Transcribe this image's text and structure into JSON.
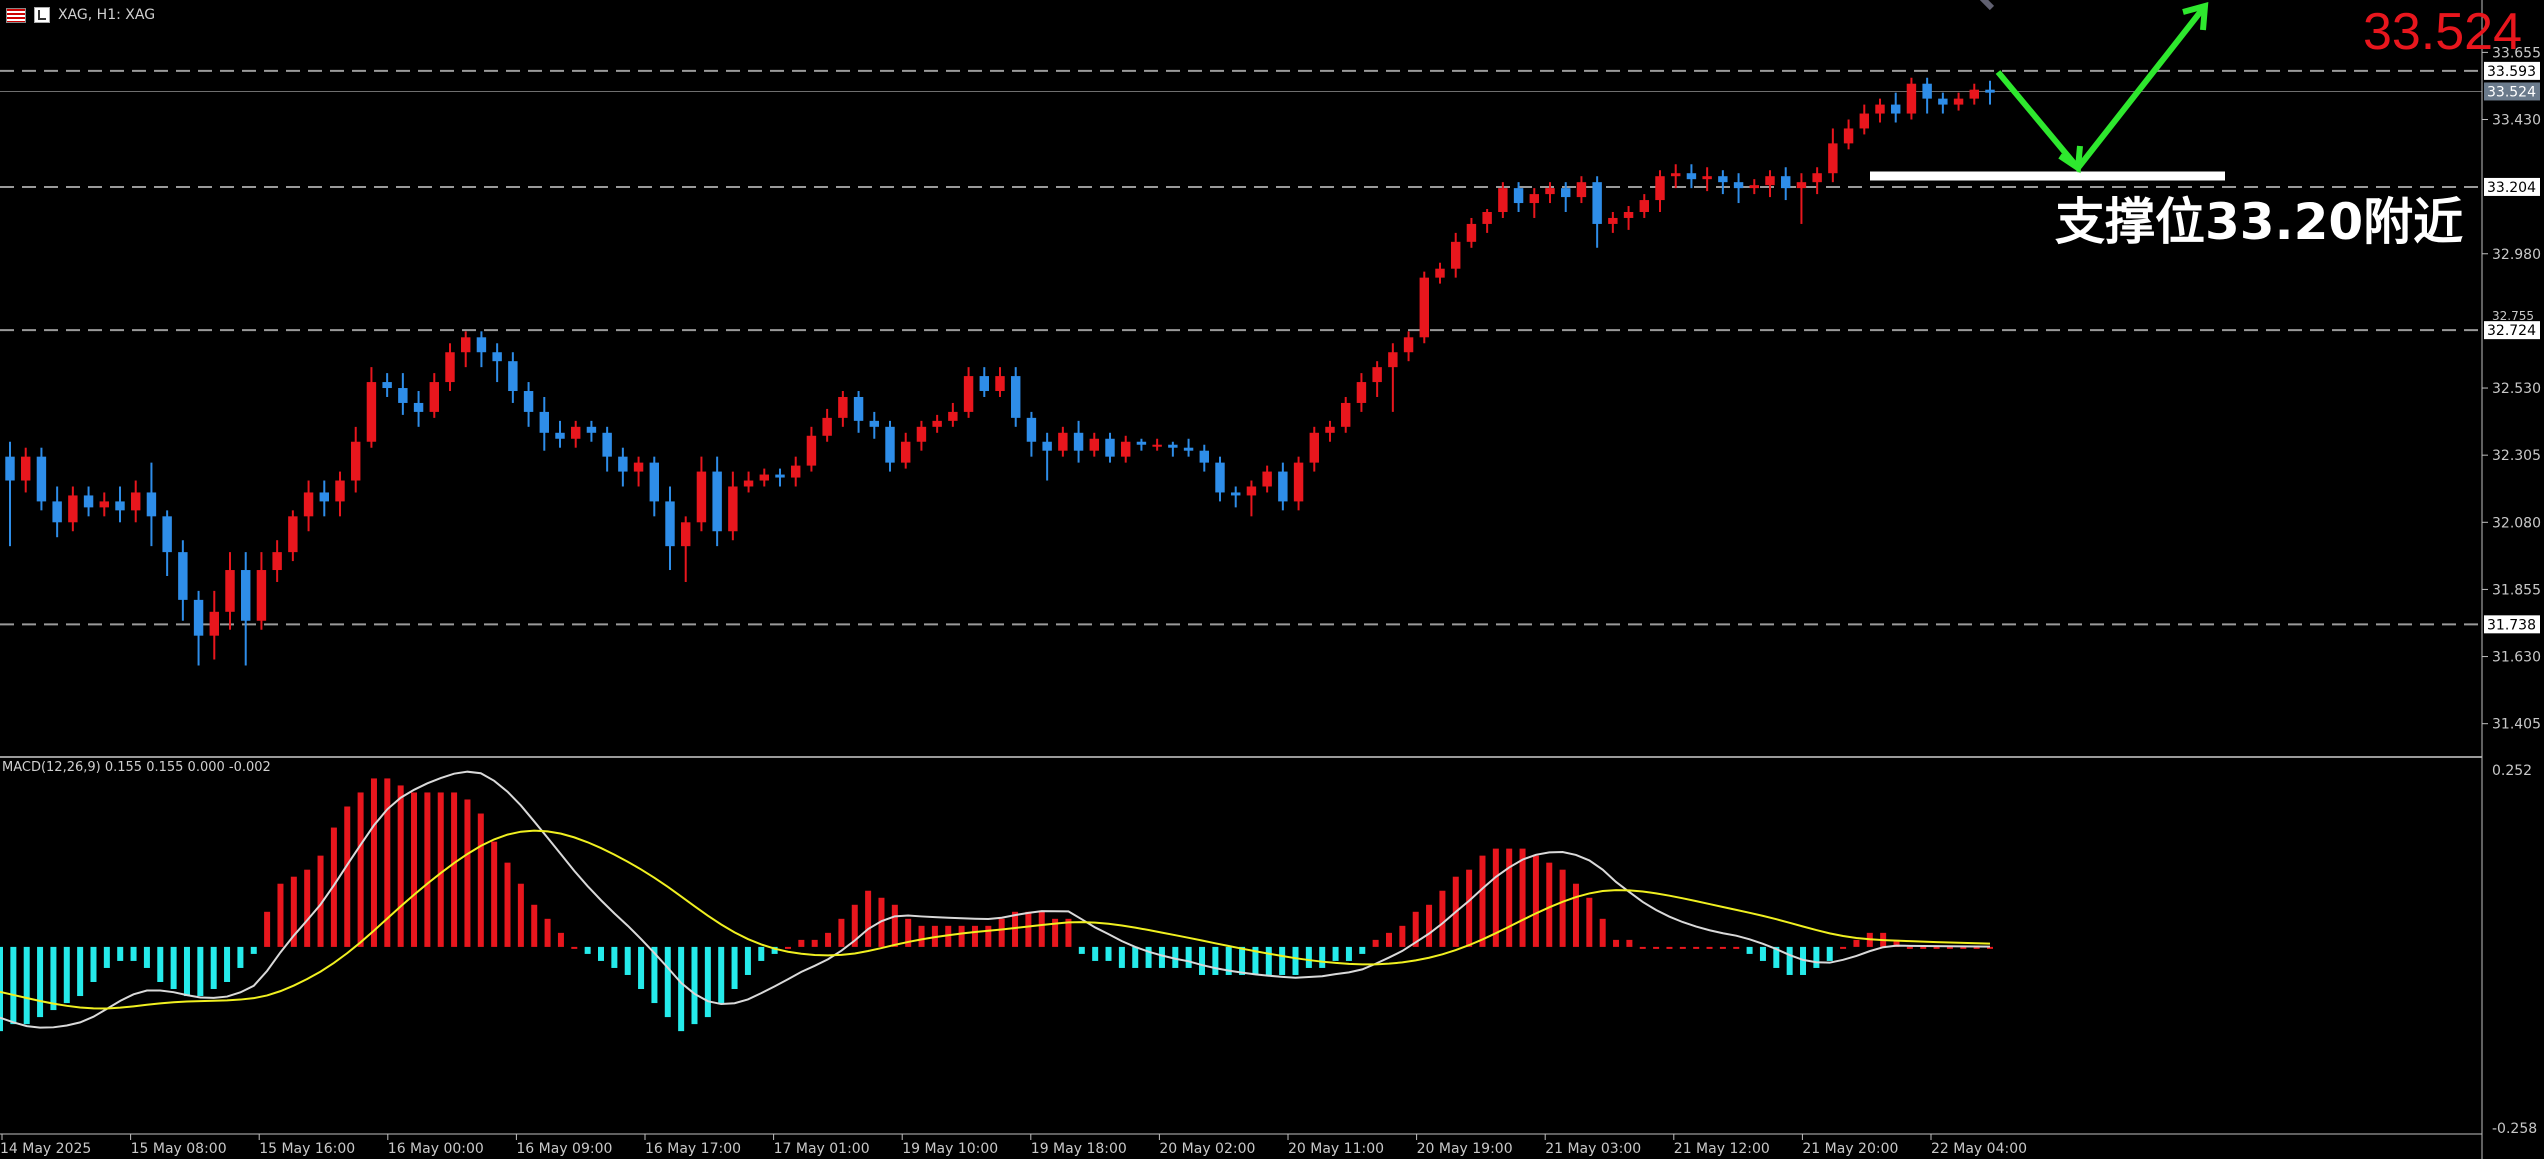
{
  "header": {
    "title": "XAG, H1: XAG",
    "flag_icon": "us-flag-icon",
    "symbol_icon": "chart-symbol-icon"
  },
  "annotations": {
    "price_label": "33.524",
    "support_label": "支撑位33.20附近"
  },
  "macd": {
    "label": "MACD(12,26,9) 0.155 0.155 0.000 -0.002",
    "axis_max": "0.252",
    "axis_min": "-0.258",
    "hist": [
      -0.12,
      -0.11,
      -0.11,
      -0.1,
      -0.09,
      -0.08,
      -0.07,
      -0.05,
      -0.03,
      -0.02,
      -0.02,
      -0.03,
      -0.05,
      -0.06,
      -0.07,
      -0.07,
      -0.06,
      -0.05,
      -0.03,
      -0.01,
      0.05,
      0.09,
      0.1,
      0.11,
      0.13,
      0.17,
      0.2,
      0.22,
      0.24,
      0.24,
      0.23,
      0.22,
      0.22,
      0.22,
      0.22,
      0.21,
      0.19,
      0.15,
      0.12,
      0.09,
      0.06,
      0.04,
      0.02,
      0.0,
      -0.01,
      -0.02,
      -0.03,
      -0.04,
      -0.06,
      -0.08,
      -0.1,
      -0.12,
      -0.11,
      -0.1,
      -0.08,
      -0.06,
      -0.04,
      -0.02,
      -0.01,
      0.0,
      0.01,
      0.01,
      0.02,
      0.04,
      0.06,
      0.08,
      0.07,
      0.06,
      0.04,
      0.03,
      0.03,
      0.03,
      0.03,
      0.03,
      0.03,
      0.04,
      0.05,
      0.05,
      0.05,
      0.04,
      0.04,
      -0.01,
      -0.02,
      -0.02,
      -0.03,
      -0.03,
      -0.03,
      -0.03,
      -0.03,
      -0.03,
      -0.04,
      -0.04,
      -0.04,
      -0.04,
      -0.04,
      -0.04,
      -0.04,
      -0.04,
      -0.03,
      -0.03,
      -0.02,
      -0.02,
      -0.01,
      0.01,
      0.02,
      0.03,
      0.05,
      0.06,
      0.08,
      0.1,
      0.11,
      0.13,
      0.14,
      0.14,
      0.14,
      0.13,
      0.12,
      0.11,
      0.09,
      0.07,
      0.04,
      0.01,
      0.01,
      0.0,
      0.0,
      0.0,
      0.0,
      0.0,
      0.0,
      0.0,
      0.0,
      -0.01,
      -0.02,
      -0.03,
      -0.04,
      -0.04,
      -0.03,
      -0.02,
      0.0,
      0.01,
      0.02,
      0.02,
      0.01,
      0.0,
      0.0,
      0.0,
      0.0,
      0.0,
      0.0,
      0.0
    ]
  },
  "price_axis": {
    "ticks": [
      "33.655",
      "33.430",
      "32.980",
      "32.530",
      "32.305",
      "32.080",
      "31.855",
      "31.630",
      "31.405"
    ],
    "boxed": [
      {
        "label": "33.593",
        "style": "level"
      },
      {
        "label": "33.524",
        "style": "bid"
      },
      {
        "label": "33.204",
        "style": "level"
      },
      {
        "label": "32.724",
        "style": "level"
      },
      {
        "label": "31.738",
        "style": "level"
      }
    ],
    "partial_label": "32.755"
  },
  "time_axis": [
    "14 May 2025",
    "15 May 08:00",
    "15 May 16:00",
    "16 May 00:00",
    "16 May 09:00",
    "16 May 17:00",
    "17 May 01:00",
    "19 May 10:00",
    "19 May 18:00",
    "20 May 02:00",
    "20 May 11:00",
    "20 May 19:00",
    "21 May 03:00",
    "21 May 12:00",
    "21 May 20:00",
    "22 May 04:00"
  ],
  "colors": {
    "bull": "#e8161d",
    "bear": "#2e8de8",
    "macd_pos": "#e8161d",
    "macd_neg": "#25ebeb",
    "macd_line": "#d9d9d9",
    "signal_line": "#f0f020",
    "arrow": "#2ee82e",
    "support_bar": "#ffffff"
  },
  "chart_data": {
    "type": "candlestick",
    "title": "XAG, H1",
    "y_range": [
      31.29,
      33.73
    ],
    "horizontal_levels": [
      33.593,
      33.204,
      32.724,
      31.738
    ],
    "current_price": 33.524,
    "candles": [
      [
        32.3,
        32.22,
        32.35,
        32.0
      ],
      [
        32.22,
        32.3,
        32.33,
        32.18
      ],
      [
        32.3,
        32.15,
        32.33,
        32.12
      ],
      [
        32.15,
        32.08,
        32.2,
        32.03
      ],
      [
        32.08,
        32.17,
        32.2,
        32.05
      ],
      [
        32.17,
        32.13,
        32.2,
        32.1
      ],
      [
        32.13,
        32.15,
        32.18,
        32.1
      ],
      [
        32.15,
        32.12,
        32.2,
        32.08
      ],
      [
        32.12,
        32.18,
        32.22,
        32.08
      ],
      [
        32.18,
        32.1,
        32.28,
        32.0
      ],
      [
        32.1,
        31.98,
        32.12,
        31.9
      ],
      [
        31.98,
        31.82,
        32.02,
        31.75
      ],
      [
        31.82,
        31.7,
        31.85,
        31.6
      ],
      [
        31.7,
        31.78,
        31.85,
        31.62
      ],
      [
        31.78,
        31.92,
        31.98,
        31.72
      ],
      [
        31.92,
        31.75,
        31.98,
        31.6
      ],
      [
        31.75,
        31.92,
        31.98,
        31.72
      ],
      [
        31.92,
        31.98,
        32.02,
        31.88
      ],
      [
        31.98,
        32.1,
        32.12,
        31.95
      ],
      [
        32.1,
        32.18,
        32.22,
        32.05
      ],
      [
        32.18,
        32.15,
        32.22,
        32.1
      ],
      [
        32.15,
        32.22,
        32.25,
        32.1
      ],
      [
        32.22,
        32.35,
        32.4,
        32.18
      ],
      [
        32.35,
        32.55,
        32.6,
        32.33
      ],
      [
        32.55,
        32.53,
        32.58,
        32.5
      ],
      [
        32.53,
        32.48,
        32.58,
        32.44
      ],
      [
        32.48,
        32.45,
        32.52,
        32.4
      ],
      [
        32.45,
        32.55,
        32.58,
        32.43
      ],
      [
        32.55,
        32.65,
        32.68,
        32.52
      ],
      [
        32.65,
        32.7,
        32.72,
        32.6
      ],
      [
        32.7,
        32.65,
        32.72,
        32.6
      ],
      [
        32.65,
        32.62,
        32.68,
        32.55
      ],
      [
        32.62,
        32.52,
        32.65,
        32.48
      ],
      [
        32.52,
        32.45,
        32.55,
        32.4
      ],
      [
        32.45,
        32.38,
        32.5,
        32.32
      ],
      [
        32.38,
        32.36,
        32.42,
        32.33
      ],
      [
        32.36,
        32.4,
        32.42,
        32.33
      ],
      [
        32.4,
        32.38,
        32.42,
        32.35
      ],
      [
        32.38,
        32.3,
        32.4,
        32.25
      ],
      [
        32.3,
        32.25,
        32.33,
        32.2
      ],
      [
        32.25,
        32.28,
        32.3,
        32.2
      ],
      [
        32.28,
        32.15,
        32.3,
        32.1
      ],
      [
        32.15,
        32.0,
        32.2,
        31.92
      ],
      [
        32.0,
        32.08,
        32.1,
        31.88
      ],
      [
        32.08,
        32.25,
        32.3,
        32.05
      ],
      [
        32.25,
        32.05,
        32.3,
        32.0
      ],
      [
        32.05,
        32.2,
        32.25,
        32.02
      ],
      [
        32.2,
        32.22,
        32.25,
        32.18
      ],
      [
        32.22,
        32.24,
        32.26,
        32.2
      ],
      [
        32.24,
        32.23,
        32.26,
        32.2
      ],
      [
        32.23,
        32.27,
        32.3,
        32.2
      ],
      [
        32.27,
        32.37,
        32.4,
        32.25
      ],
      [
        32.37,
        32.43,
        32.46,
        32.35
      ],
      [
        32.43,
        32.5,
        32.52,
        32.4
      ],
      [
        32.5,
        32.42,
        32.52,
        32.38
      ],
      [
        32.42,
        32.4,
        32.45,
        32.36
      ],
      [
        32.4,
        32.28,
        32.42,
        32.25
      ],
      [
        32.28,
        32.35,
        32.38,
        32.26
      ],
      [
        32.35,
        32.4,
        32.42,
        32.32
      ],
      [
        32.4,
        32.42,
        32.44,
        32.38
      ],
      [
        32.42,
        32.45,
        32.48,
        32.4
      ],
      [
        32.45,
        32.57,
        32.6,
        32.43
      ],
      [
        32.57,
        32.52,
        32.6,
        32.5
      ],
      [
        32.52,
        32.57,
        32.6,
        32.5
      ],
      [
        32.57,
        32.43,
        32.6,
        32.4
      ],
      [
        32.43,
        32.35,
        32.45,
        32.3
      ],
      [
        32.35,
        32.32,
        32.38,
        32.22
      ],
      [
        32.32,
        32.38,
        32.4,
        32.3
      ],
      [
        32.38,
        32.32,
        32.42,
        32.28
      ],
      [
        32.32,
        32.36,
        32.38,
        32.3
      ],
      [
        32.36,
        32.3,
        32.38,
        32.28
      ],
      [
        32.3,
        32.35,
        32.37,
        32.28
      ],
      [
        32.35,
        32.34,
        32.36,
        32.32
      ],
      [
        32.34,
        32.34,
        32.36,
        32.32
      ],
      [
        32.34,
        32.33,
        32.35,
        32.3
      ],
      [
        32.33,
        32.32,
        32.36,
        32.3
      ],
      [
        32.32,
        32.28,
        32.34,
        32.25
      ],
      [
        32.28,
        32.18,
        32.3,
        32.15
      ],
      [
        32.18,
        32.17,
        32.2,
        32.13
      ],
      [
        32.17,
        32.2,
        32.22,
        32.1
      ],
      [
        32.2,
        32.25,
        32.27,
        32.18
      ],
      [
        32.25,
        32.15,
        32.28,
        32.12
      ],
      [
        32.15,
        32.28,
        32.3,
        32.12
      ],
      [
        32.28,
        32.38,
        32.4,
        32.25
      ],
      [
        32.38,
        32.4,
        32.42,
        32.35
      ],
      [
        32.4,
        32.48,
        32.5,
        32.38
      ],
      [
        32.48,
        32.55,
        32.58,
        32.45
      ],
      [
        32.55,
        32.6,
        32.62,
        32.5
      ],
      [
        32.6,
        32.65,
        32.68,
        32.45
      ],
      [
        32.65,
        32.7,
        32.72,
        32.62
      ],
      [
        32.7,
        32.9,
        32.92,
        32.68
      ],
      [
        32.9,
        32.93,
        32.95,
        32.88
      ],
      [
        32.93,
        33.02,
        33.05,
        32.9
      ],
      [
        33.02,
        33.08,
        33.1,
        33.0
      ],
      [
        33.08,
        33.12,
        33.13,
        33.05
      ],
      [
        33.12,
        33.2,
        33.22,
        33.1
      ],
      [
        33.2,
        33.15,
        33.22,
        33.12
      ],
      [
        33.15,
        33.18,
        33.2,
        33.1
      ],
      [
        33.18,
        33.2,
        33.22,
        33.15
      ],
      [
        33.2,
        33.17,
        33.22,
        33.12
      ],
      [
        33.17,
        33.22,
        33.24,
        33.15
      ],
      [
        33.22,
        33.08,
        33.24,
        33.0
      ],
      [
        33.08,
        33.1,
        33.12,
        33.05
      ],
      [
        33.1,
        33.12,
        33.14,
        33.06
      ],
      [
        33.12,
        33.16,
        33.18,
        33.1
      ],
      [
        33.16,
        33.24,
        33.26,
        33.12
      ],
      [
        33.24,
        33.25,
        33.28,
        33.2
      ],
      [
        33.25,
        33.23,
        33.28,
        33.2
      ],
      [
        33.23,
        33.24,
        33.27,
        33.19
      ],
      [
        33.24,
        33.22,
        33.26,
        33.18
      ],
      [
        33.22,
        33.2,
        33.25,
        33.15
      ],
      [
        33.2,
        33.21,
        33.23,
        33.18
      ],
      [
        33.21,
        33.24,
        33.26,
        33.17
      ],
      [
        33.24,
        33.2,
        33.27,
        33.16
      ],
      [
        33.2,
        33.22,
        33.25,
        33.08
      ],
      [
        33.22,
        33.25,
        33.27,
        33.18
      ],
      [
        33.25,
        33.35,
        33.4,
        33.22
      ],
      [
        33.35,
        33.4,
        33.43,
        33.33
      ],
      [
        33.4,
        33.45,
        33.48,
        33.38
      ],
      [
        33.45,
        33.48,
        33.5,
        33.42
      ],
      [
        33.48,
        33.45,
        33.52,
        33.42
      ],
      [
        33.45,
        33.55,
        33.57,
        33.43
      ],
      [
        33.55,
        33.5,
        33.57,
        33.45
      ],
      [
        33.5,
        33.48,
        33.52,
        33.45
      ],
      [
        33.48,
        33.5,
        33.52,
        33.46
      ],
      [
        33.5,
        33.53,
        33.55,
        33.48
      ],
      [
        33.53,
        33.52,
        33.56,
        33.48
      ]
    ]
  }
}
